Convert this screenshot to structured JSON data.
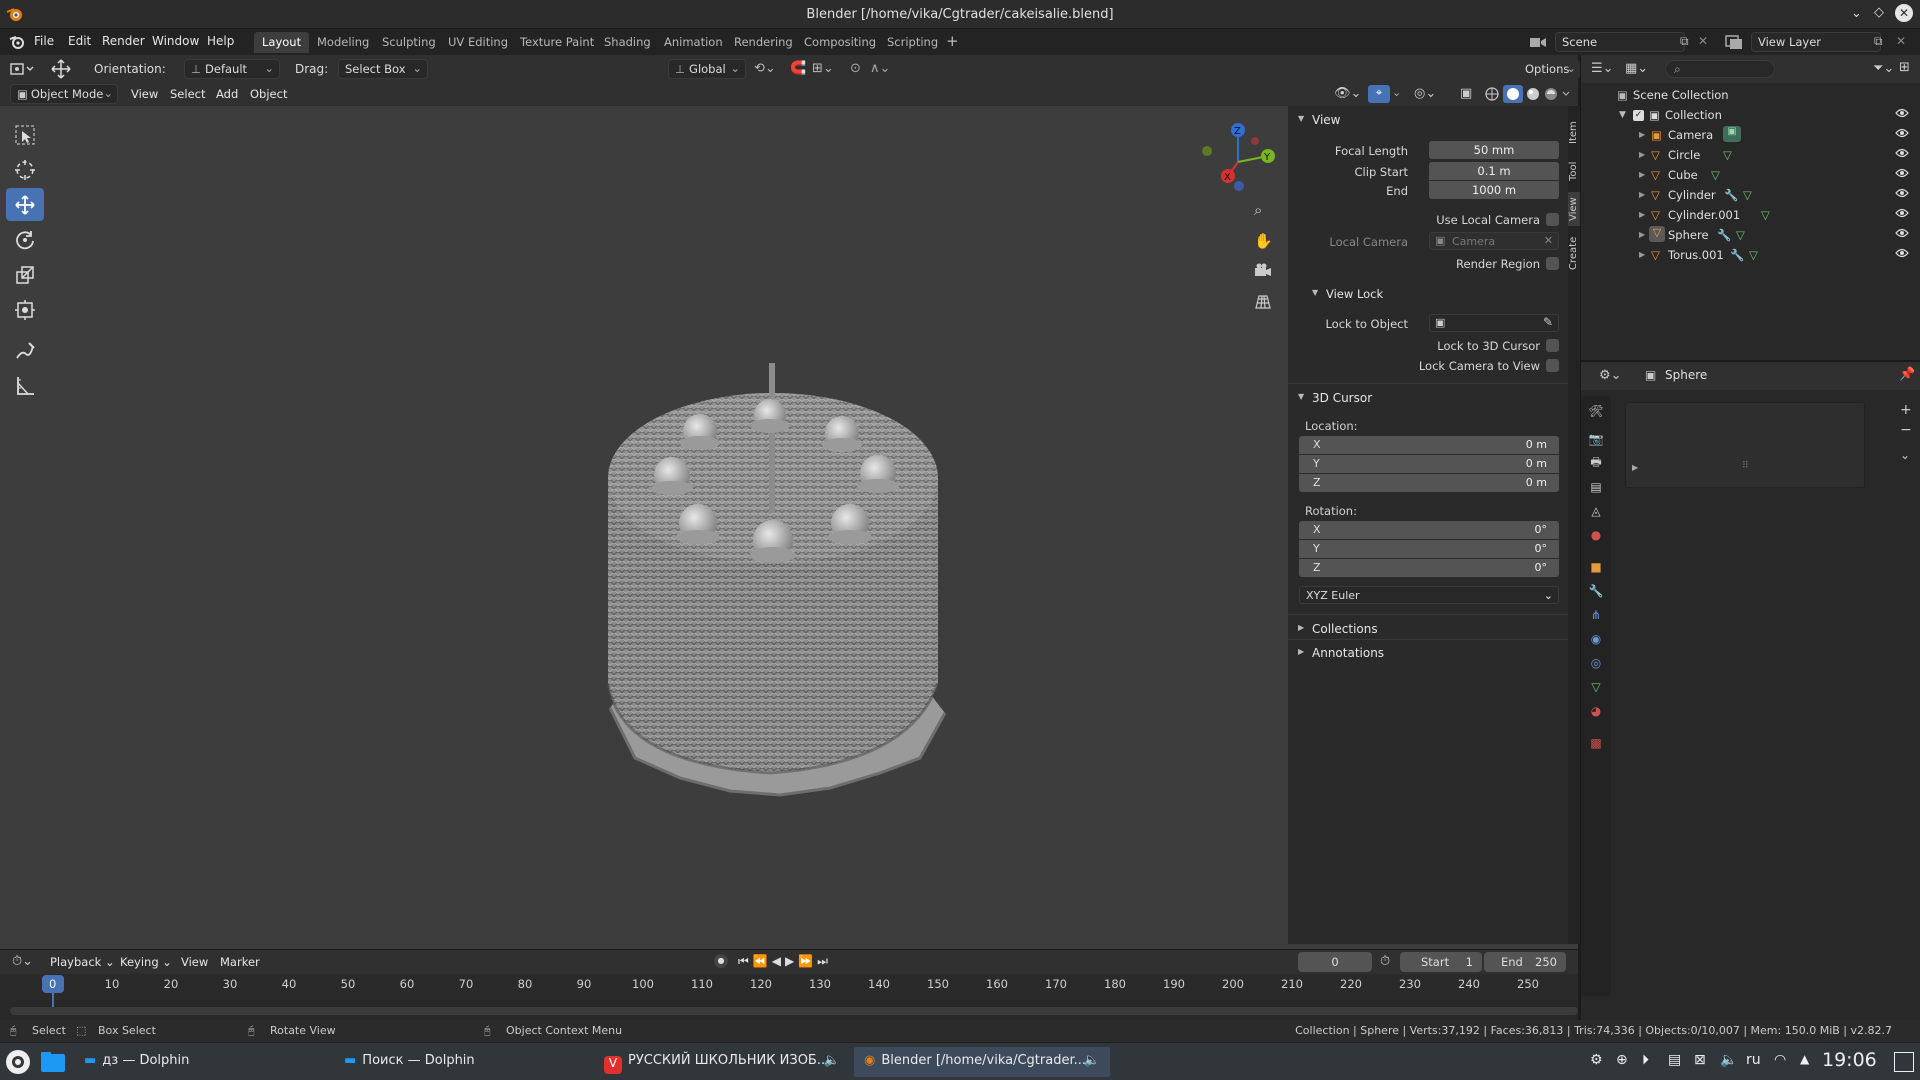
{
  "window": {
    "title": "Blender [/home/vika/Cgtrader/cakeisalie.blend]"
  },
  "menu": {
    "items": [
      "File",
      "Edit",
      "Render",
      "Window",
      "Help"
    ]
  },
  "workspaces": {
    "tabs": [
      "Layout",
      "Modeling",
      "Sculpting",
      "UV Editing",
      "Texture Paint",
      "Shading",
      "Animation",
      "Rendering",
      "Compositing",
      "Scripting"
    ],
    "active": "Layout"
  },
  "topright": {
    "scene": "Scene",
    "view_layer": "View Layer"
  },
  "header": {
    "orientation_label": "Orientation:",
    "orientation_value": "Default",
    "drag_label": "Drag:",
    "drag_value": "Select Box",
    "transform": "Global",
    "options": "Options"
  },
  "header2": {
    "mode": "Object Mode",
    "items": [
      "View",
      "Select",
      "Add",
      "Object"
    ]
  },
  "npanel": {
    "view_section": "View",
    "focal_length_label": "Focal Length",
    "focal_length": "50 mm",
    "clip_start_label": "Clip Start",
    "clip_start": "0.1 m",
    "end_label": "End",
    "end": "1000 m",
    "use_local_camera": "Use Local Camera",
    "local_camera_label": "Local Camera",
    "local_camera_value": "Camera",
    "render_region": "Render Region",
    "view_lock_section": "View Lock",
    "lock_to_object": "Lock to Object",
    "lock_to_3d_cursor": "Lock to 3D Cursor",
    "lock_camera_to_view": "Lock Camera to View",
    "cursor_section": "3D Cursor",
    "location_label": "Location:",
    "location": [
      {
        "k": "X",
        "v": "0 m"
      },
      {
        "k": "Y",
        "v": "0 m"
      },
      {
        "k": "Z",
        "v": "0 m"
      }
    ],
    "rotation_label": "Rotation:",
    "rotation": [
      {
        "k": "X",
        "v": "0°"
      },
      {
        "k": "Y",
        "v": "0°"
      },
      {
        "k": "Z",
        "v": "0°"
      }
    ],
    "rotation_mode": "XYZ Euler",
    "collections_section": "Collections",
    "annotations_section": "Annotations"
  },
  "sidetabs": [
    "Item",
    "Tool",
    "View",
    "Create"
  ],
  "outliner": {
    "scene_collection": "Scene Collection",
    "collection": "Collection",
    "objects": [
      "Camera",
      "Circle",
      "Cube",
      "Cylinder",
      "Cylinder.001",
      "Sphere",
      "Torus.001"
    ]
  },
  "properties": {
    "object_name": "Sphere"
  },
  "timeline": {
    "menus": [
      "Playback",
      "Keying",
      "View",
      "Marker"
    ],
    "current_frame": "0",
    "start_label": "Start",
    "start": "1",
    "end_label": "End",
    "end": "250",
    "ticks": [
      "0",
      "10",
      "20",
      "30",
      "40",
      "50",
      "60",
      "70",
      "80",
      "90",
      "100",
      "110",
      "120",
      "130",
      "140",
      "150",
      "160",
      "170",
      "180",
      "190",
      "200",
      "210",
      "220",
      "230",
      "240",
      "250"
    ]
  },
  "status": {
    "select": "Select",
    "box_select": "Box Select",
    "rotate_view": "Rotate View",
    "context_menu": "Object Context Menu",
    "stats": "Collection | Sphere | Verts:37,192 | Faces:36,813 | Tris:74,336 | Objects:0/10,007 | Mem: 150.0 MiB | v2.82.7"
  },
  "taskbar": {
    "tasks": [
      "дз — Dolphin",
      "Поиск — Dolphin",
      "РУССКИЙ ШКОЛЬНИК ИЗОБ...",
      "Blender [/home/vika/Cgtrader..."
    ],
    "lang": "ru",
    "clock": "19:06"
  }
}
